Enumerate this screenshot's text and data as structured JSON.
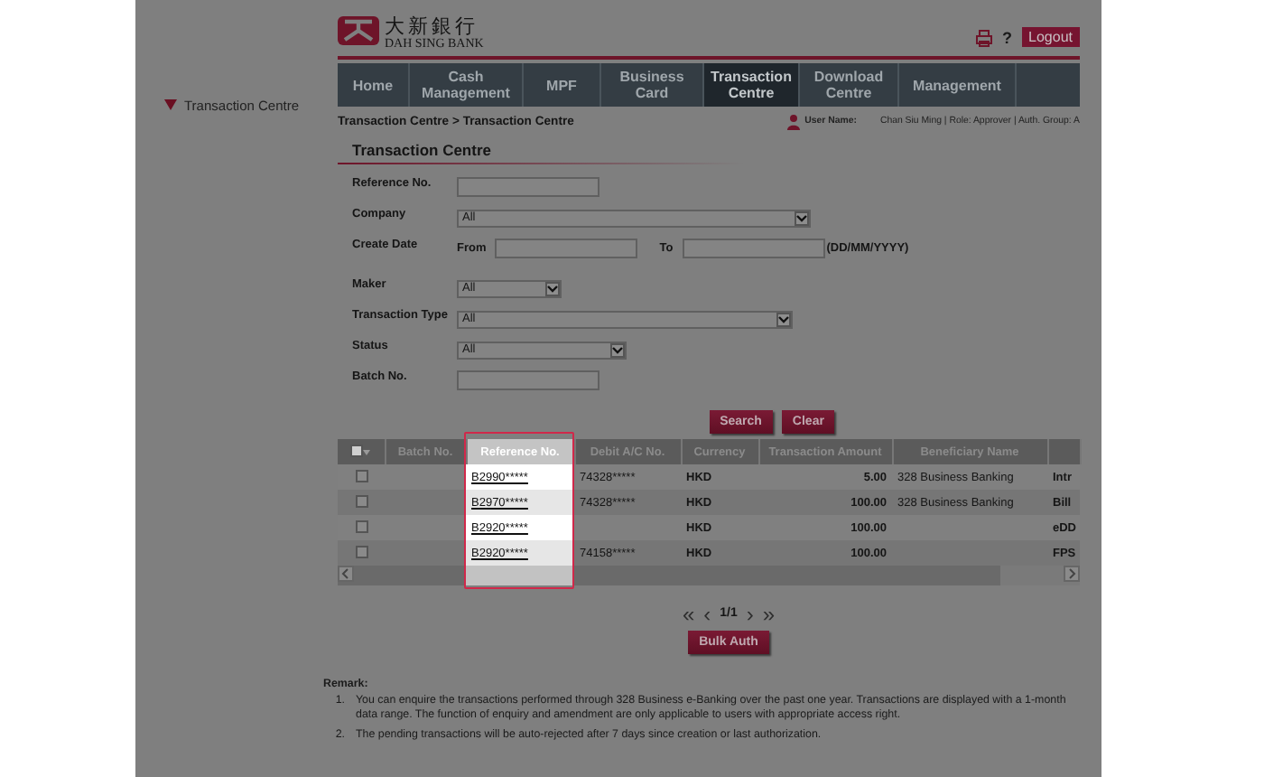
{
  "sidebar": {
    "items": [
      {
        "label": "Transaction Centre",
        "expanded": true
      }
    ]
  },
  "header": {
    "logo_chinese": "大新銀行",
    "logo_english": "DAH SING BANK",
    "help": "?",
    "logout": "Logout"
  },
  "nav": {
    "items": [
      {
        "label": "Home",
        "selected": false
      },
      {
        "label": "Cash Management",
        "selected": false
      },
      {
        "label": "MPF",
        "selected": false
      },
      {
        "label": "Business Card",
        "selected": false
      },
      {
        "label": "Transaction Centre",
        "selected": true
      },
      {
        "label": "Download Centre",
        "selected": false
      },
      {
        "label": "Management",
        "selected": false
      }
    ]
  },
  "breadcrumb": "Transaction Centre > Transaction Centre",
  "user": {
    "label": "User Name:",
    "value": "Chan Siu Ming | Role: Approver | Auth. Group: A"
  },
  "title": "Transaction Centre",
  "form": {
    "fields": [
      {
        "label": "Reference No.",
        "kind": "text"
      },
      {
        "label": "Company",
        "kind": "select",
        "value": "All"
      },
      {
        "label": "Create Date",
        "kind": "daterange",
        "from_label": "From",
        "to_label": "To",
        "hint": "(DD/MM/YYYY)"
      },
      {
        "label": "Maker",
        "kind": "select",
        "value": "All"
      },
      {
        "label": "Transaction Type",
        "kind": "select",
        "value": "All"
      },
      {
        "label": "Status",
        "kind": "select",
        "value": "All"
      },
      {
        "label": "Batch No.",
        "kind": "text"
      }
    ],
    "buttons": [
      "Search",
      "Clear"
    ]
  },
  "table": {
    "select_all": {
      "checked": false
    },
    "columns": [
      {
        "label": "Batch No.",
        "highlighted": false
      },
      {
        "label": "Reference No.",
        "highlighted": true
      },
      {
        "label": "Debit A/C No.",
        "highlighted": false
      },
      {
        "label": "Currency",
        "highlighted": false
      },
      {
        "label": "Transaction Amount",
        "highlighted": false
      },
      {
        "label": "Beneficiary Name",
        "highlighted": false
      },
      {
        "highlighted": false
      }
    ],
    "rows": [
      {
        "checked": false,
        "cells": [
          null,
          "B2990*****",
          "74328*****",
          "HKD",
          "5.00",
          "328 Business Banking",
          "Intr"
        ]
      },
      {
        "checked": false,
        "cells": [
          null,
          "B2970*****",
          "74328*****",
          "HKD",
          "100.00",
          "328 Business Banking",
          "Bill"
        ]
      },
      {
        "checked": false,
        "cells": [
          null,
          "B2920*****",
          null,
          "HKD",
          "100.00",
          null,
          "eDD"
        ]
      },
      {
        "checked": false,
        "cells": [
          null,
          "B2920*****",
          "74158*****",
          "HKD",
          "100.00",
          null,
          "FPS"
        ]
      }
    ]
  },
  "pager": {
    "first": "«",
    "prev": "‹",
    "page": "1/1",
    "next": "›",
    "last": "»"
  },
  "bulk_button": "Bulk Auth",
  "remark": {
    "title": "Remark:",
    "items": [
      {
        "number": "1.",
        "text": "You can enquire the transactions performed through 328 Business e-Banking over the past one year. Transactions are displayed with a 1-month data range. The function of enquiry and amendment are only applicable to users with appropriate access right."
      },
      {
        "number": "2.",
        "text": "The pending transactions will be auto-rejected after 7 days since creation or last authorization."
      }
    ]
  }
}
